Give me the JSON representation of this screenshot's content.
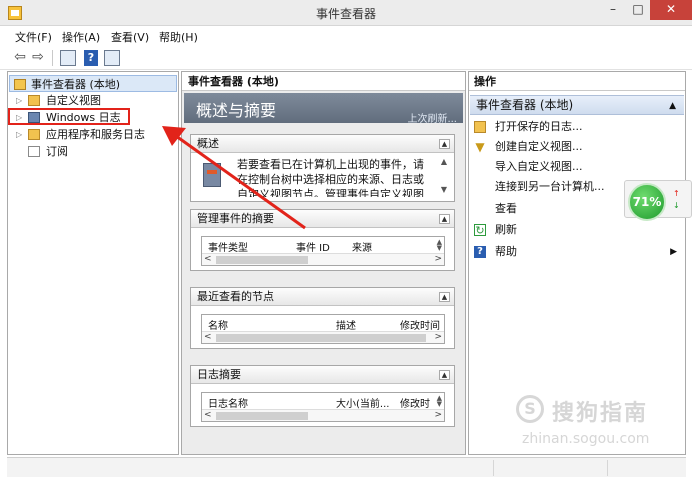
{
  "window": {
    "title": "事件查看器",
    "minimize": "–",
    "maximize": "□",
    "close": "✕"
  },
  "menu": [
    "文件(F)",
    "操作(A)",
    "查看(V)",
    "帮助(H)"
  ],
  "toolbar": {
    "back": "⇦",
    "forward": "⇨",
    "help": "?"
  },
  "tree": {
    "root": "事件查看器 (本地)",
    "items": [
      {
        "label": "自定义视图",
        "toggle": "▷"
      },
      {
        "label": "Windows 日志",
        "toggle": "▷"
      },
      {
        "label": "应用程序和服务日志",
        "toggle": "▷"
      },
      {
        "label": "订阅",
        "toggle": ""
      }
    ]
  },
  "center": {
    "header": "事件查看器 (本地)",
    "overview_title": "概述与摘要",
    "last_refresh": "上次刷新...",
    "summary_panel": {
      "title": "概述",
      "text": "若要查看已在计算机上出现的事件，请在控制台树中选择相应的来源、日志或自定义视图节点。管理事件自定义视图包含..."
    },
    "admin_panel": {
      "title": "管理事件的摘要",
      "columns": [
        "事件类型",
        "事件 ID",
        "来源"
      ]
    },
    "recent_panel": {
      "title": "最近查看的节点",
      "columns": [
        "名称",
        "描述",
        "修改时间"
      ]
    },
    "log_panel": {
      "title": "日志摘要",
      "columns": [
        "日志名称",
        "大小(当前...",
        "修改时"
      ]
    }
  },
  "actions": {
    "header": "操作",
    "section": "事件查看器 (本地)",
    "items": [
      {
        "label": "打开保存的日志...",
        "icon": "folder-open-icon"
      },
      {
        "label": "创建自定义视图...",
        "icon": "filter-icon"
      },
      {
        "label": "导入自定义视图...",
        "icon": ""
      },
      {
        "label": "连接到另一台计算机...",
        "icon": ""
      },
      {
        "label": "查看",
        "icon": "",
        "submenu": true
      },
      {
        "label": "刷新",
        "icon": "refresh-icon"
      },
      {
        "label": "帮助",
        "icon": "help-icon",
        "submenu": true
      }
    ]
  },
  "overlay": {
    "speed_percent": "71%"
  },
  "watermark": {
    "brand": "搜狗指南",
    "url": "zhinan.sogou.com"
  },
  "colors": {
    "annotation_red": "#e2231a",
    "accent": "#2a5db0"
  }
}
